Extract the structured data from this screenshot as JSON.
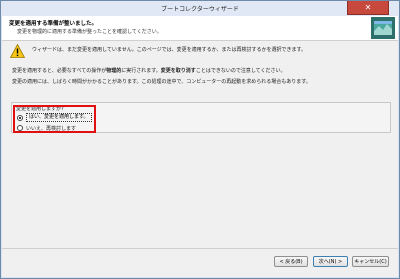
{
  "window": {
    "title": "ブートコレクターウィザード",
    "close_label": "✕"
  },
  "header": {
    "title": "変更を適用する準備が整いました。",
    "subtitle": "変更を物理的に適用する準備が整ったことを確認してください。",
    "logo_icon": "wizard-logo-icon"
  },
  "body": {
    "warning_text": "ウィザードは、まだ変更を適用していません。このページでは、変更を適用するか、または再検討するかを選択できます。",
    "line2_a": "変更を適用すると、必要なすべての操作が",
    "line2_bold1": "物理的",
    "line2_b": "に実行されます。",
    "line2_bold2": "変更を取り消す",
    "line2_c": "ことはできないので注意してください。",
    "line3": "変更の適用には、しばらく時間がかかることがあります。この処理の途中で、コンピューターの再起動を求められる場合もあります。"
  },
  "apply_group": {
    "label": "変更を適用しますか?",
    "option_yes": "はい、変更を適用します。",
    "option_no": "いいえ、再検討します",
    "selected": "yes"
  },
  "footer": {
    "back_label": "< 戻る(B)",
    "next_label": "次へ(N) >",
    "cancel_label": "キャンセル(C)"
  },
  "colors": {
    "highlight": "#e01010",
    "warning_yellow": "#f5c518"
  }
}
